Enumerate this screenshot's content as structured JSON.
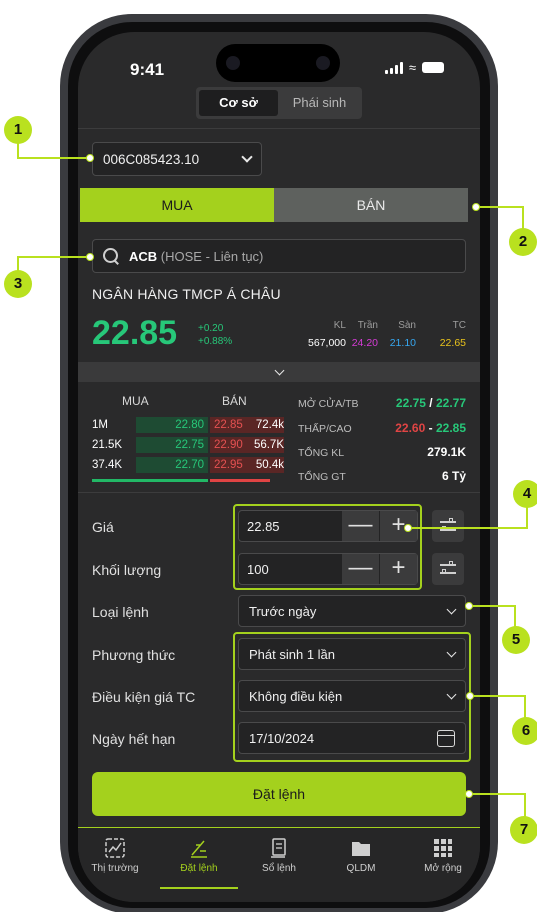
{
  "status": {
    "time": "9:41"
  },
  "segment": {
    "spot": "Cơ sở",
    "derivative": "Phái sinh"
  },
  "account": {
    "id": "006C085423.10"
  },
  "side": {
    "buy": "MUA",
    "sell": "BÁN"
  },
  "search": {
    "ticker": "ACB",
    "exchange": "(HOSE - Liên tục)"
  },
  "company": "NGÂN HÀNG TMCP Á CHÂU",
  "quote": {
    "price": "22.85",
    "change": "+0.20",
    "change_pct": "+0.88%",
    "headers": {
      "kl": "KL",
      "tran": "Trần",
      "san": "Sàn",
      "tc": "TC"
    },
    "kl": "567,000",
    "ceiling": "24.20",
    "floor": "21.10",
    "reference": "22.65"
  },
  "orderbook": {
    "buy_header": "MUA",
    "sell_header": "BÁN",
    "rows": [
      {
        "bid_vol": "1M",
        "bid_px": "22.80",
        "ask_px": "22.85",
        "ask_vol": "72.4k"
      },
      {
        "bid_vol": "21.5K",
        "bid_px": "22.75",
        "ask_px": "22.90",
        "ask_vol": "56.7K"
      },
      {
        "bid_vol": "37.4K",
        "bid_px": "22.70",
        "ask_px": "22.95",
        "ask_vol": "50.4k"
      }
    ]
  },
  "stats": {
    "open_avg_label": "MỞ CỬA/TB",
    "open": "22.75",
    "sep": "/",
    "avg": "22.77",
    "low_high_label": "THẤP/CAO",
    "low": "22.60",
    "dash": "-",
    "high": "22.85",
    "total_vol_label": "TỔNG KL",
    "total_vol": "279.1K",
    "total_val_label": "TỔNG GT",
    "total_val": "6 Tỷ"
  },
  "form": {
    "price_label": "Giá",
    "price": "22.85",
    "qty_label": "Khối lượng",
    "qty": "100",
    "order_type_label": "Loại lệnh",
    "order_type": "Trước ngày",
    "method_label": "Phương thức",
    "method": "Phát sinh 1 lần",
    "condition_label": "Điều kiện giá TC",
    "condition": "Không điều kiện",
    "expiry_label": "Ngày hết hạn",
    "expiry": "17/10/2024",
    "minus": "—",
    "plus": "+"
  },
  "submit": "Đặt lệnh",
  "tabs": [
    {
      "label": "Thị trường",
      "icon": "chart-icon"
    },
    {
      "label": "Đặt lệnh",
      "icon": "order-icon"
    },
    {
      "label": "Sổ lệnh",
      "icon": "orderbook-icon"
    },
    {
      "label": "QLDM",
      "icon": "folder-icon"
    },
    {
      "label": "Mở rộng",
      "icon": "grid-icon"
    }
  ],
  "callouts": [
    "1",
    "2",
    "3",
    "4",
    "5",
    "6",
    "7"
  ],
  "colors": {
    "accent": "#a4d11d",
    "up": "#27c779",
    "down": "#e04444",
    "ceiling": "#d63cd6",
    "floor": "#36a7f0",
    "ref": "#e8c21c"
  }
}
